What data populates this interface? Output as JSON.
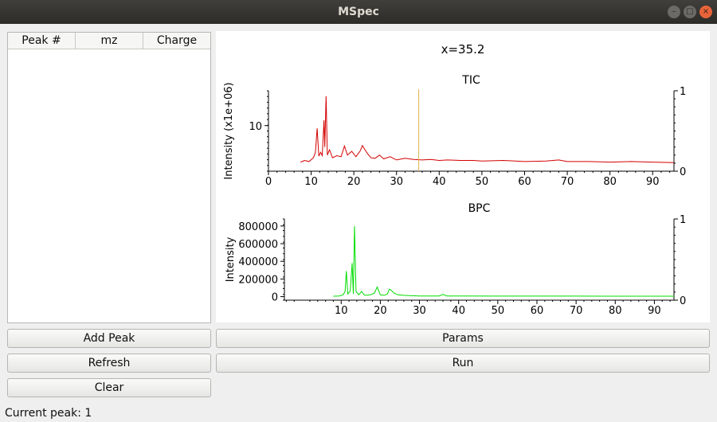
{
  "window": {
    "title": "MSpec"
  },
  "peak_table": {
    "columns": [
      "Peak #",
      "mz",
      "Charge"
    ],
    "rows": []
  },
  "plot": {
    "cursor_readout": "x=35.2"
  },
  "buttons": {
    "add_peak": "Add Peak",
    "refresh": "Refresh",
    "clear": "Clear",
    "params": "Params",
    "run": "Run"
  },
  "status": {
    "current_peak": "Current peak: 1"
  },
  "chart_data": [
    {
      "type": "line",
      "title": "TIC",
      "ylabel": "Intensity (x1e+06)",
      "xlim": [
        0,
        95
      ],
      "x_ticks": [
        0,
        10,
        20,
        30,
        40,
        50,
        60,
        70,
        80,
        90
      ],
      "y_ticks": [
        10
      ],
      "ylim": [
        1.5,
        16.5
      ],
      "right_axis_ticks": [
        0,
        1
      ],
      "color": "#d40000",
      "cursor_x": 35.2,
      "cursor_color": "#e0b24a",
      "x": [
        7.5,
        8.5,
        9.5,
        10.5,
        11.0,
        11.4,
        11.8,
        12.2,
        12.6,
        13.0,
        13.2,
        13.5,
        13.8,
        14.3,
        15.0,
        16.0,
        17.0,
        17.8,
        18.5,
        19.5,
        20.5,
        21.5,
        22.0,
        22.6,
        23.2,
        24.0,
        25.0,
        26.0,
        27.0,
        28.5,
        30.0,
        32.0,
        34.0,
        36.0,
        38.0,
        40.0,
        42.0,
        45.0,
        48.0,
        50.0,
        55.0,
        60.0,
        65.0,
        68.0,
        70.0,
        75.0,
        80.0,
        85.0,
        90.0,
        95.0
      ],
      "y": [
        3.2,
        3.5,
        3.3,
        4.0,
        5.0,
        9.5,
        4.3,
        5.0,
        4.4,
        11.0,
        6.0,
        15.5,
        4.5,
        5.5,
        4.0,
        4.4,
        4.2,
        6.2,
        4.5,
        5.2,
        4.2,
        5.3,
        6.3,
        5.5,
        4.8,
        4.0,
        3.9,
        4.5,
        3.8,
        4.2,
        3.6,
        3.9,
        3.7,
        3.6,
        3.7,
        3.5,
        3.6,
        3.5,
        3.5,
        3.4,
        3.5,
        3.3,
        3.4,
        3.6,
        3.3,
        3.3,
        3.2,
        3.3,
        3.2,
        3.1
      ]
    },
    {
      "type": "line",
      "title": "BPC",
      "ylabel": "Intensity",
      "xlim": [
        -4.5,
        95
      ],
      "x_ticks": [
        10,
        20,
        30,
        40,
        50,
        60,
        70,
        80,
        90
      ],
      "y_ticks": [
        0,
        200000,
        400000,
        600000,
        800000
      ],
      "ylim": [
        -40000,
        880000
      ],
      "right_axis_ticks": [
        0,
        1
      ],
      "color": "#00dd00",
      "x": [
        8.0,
        9.5,
        10.5,
        11.0,
        11.3,
        11.7,
        12.3,
        12.8,
        13.1,
        13.4,
        13.8,
        14.5,
        15.2,
        16.0,
        17.5,
        18.5,
        19.2,
        20.0,
        21.0,
        21.8,
        22.3,
        22.8,
        23.5,
        24.5,
        26.0,
        30.0,
        35.0,
        36.0,
        37.0,
        40.0,
        50.0,
        60.0,
        70.0,
        80.0,
        90.0,
        95.0
      ],
      "y": [
        5000,
        8000,
        20000,
        60000,
        290000,
        30000,
        60000,
        380000,
        30000,
        800000,
        60000,
        20000,
        60000,
        15000,
        20000,
        40000,
        110000,
        20000,
        15000,
        30000,
        85000,
        70000,
        40000,
        20000,
        15000,
        8000,
        8000,
        25000,
        8000,
        7000,
        6000,
        6000,
        6000,
        5000,
        5000,
        5000
      ]
    }
  ]
}
